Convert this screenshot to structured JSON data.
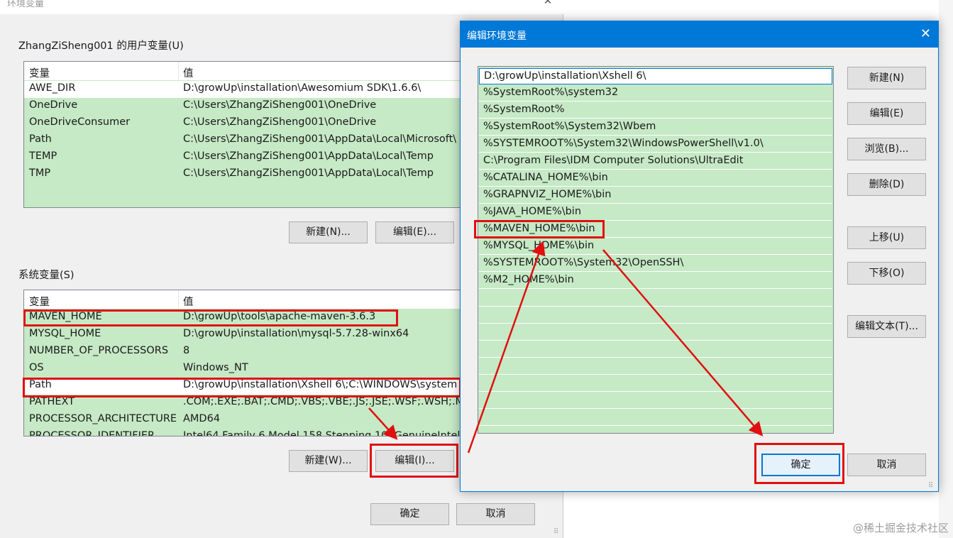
{
  "bg_dialog": {
    "title": "环境变量",
    "close_icon": "close-icon",
    "user_section": {
      "label": "ZhangZiSheng001 的用户变量(U)",
      "col_var": "变量",
      "col_val": "值",
      "rows": [
        {
          "name": "AWE_DIR",
          "value": "D:\\growUp\\installation\\Awesomium SDK\\1.6.6\\"
        },
        {
          "name": "OneDrive",
          "value": "C:\\Users\\ZhangZiSheng001\\OneDrive"
        },
        {
          "name": "OneDriveConsumer",
          "value": "C:\\Users\\ZhangZiSheng001\\OneDrive"
        },
        {
          "name": "Path",
          "value": "C:\\Users\\ZhangZiSheng001\\AppData\\Local\\Microsoft\\"
        },
        {
          "name": "TEMP",
          "value": "C:\\Users\\ZhangZiSheng001\\AppData\\Local\\Temp"
        },
        {
          "name": "TMP",
          "value": "C:\\Users\\ZhangZiSheng001\\AppData\\Local\\Temp"
        }
      ],
      "new_button": "新建(N)...",
      "edit_button": "编辑(E)..."
    },
    "system_section": {
      "label": "系统变量(S)",
      "col_var": "变量",
      "col_val": "值",
      "rows": [
        {
          "name": "MAVEN_HOME",
          "value": "D:\\growUp\\tools\\apache-maven-3.6.3"
        },
        {
          "name": "MYSQL_HOME",
          "value": "D:\\growUp\\installation\\mysql-5.7.28-winx64"
        },
        {
          "name": "NUMBER_OF_PROCESSORS",
          "value": "8"
        },
        {
          "name": "OS",
          "value": "Windows_NT"
        },
        {
          "name": "Path",
          "value": "D:\\growUp\\installation\\Xshell 6\\;C:\\WINDOWS\\system"
        },
        {
          "name": "PATHEXT",
          "value": ".COM;.EXE;.BAT;.CMD;.VBS;.VBE;.JS;.JSE;.WSF;.WSH;.M"
        },
        {
          "name": "PROCESSOR_ARCHITECTURE",
          "value": "AMD64"
        },
        {
          "name": "PROCESSOR_IDENTIFIER",
          "value": "Intel64 Family 6 Model 158 Stepping 10, GenuineIntel"
        }
      ],
      "new_button": "新建(W)...",
      "edit_button": "编辑(I)..."
    },
    "ok_button": "确定",
    "cancel_button": "取消"
  },
  "fg_dialog": {
    "title": "编辑环境变量",
    "close_icon": "close-icon",
    "paths": [
      "D:\\growUp\\installation\\Xshell 6\\",
      "%SystemRoot%\\system32",
      "%SystemRoot%",
      "%SystemRoot%\\System32\\Wbem",
      "%SYSTEMROOT%\\System32\\WindowsPowerShell\\v1.0\\",
      "C:\\Program Files\\IDM Computer Solutions\\UltraEdit",
      "%CATALINA_HOME%\\bin",
      "%GRAPNVIZ_HOME%\\bin",
      "%JAVA_HOME%\\bin",
      "%MAVEN_HOME%\\bin",
      "%MYSQL_HOME%\\bin",
      "%SYSTEMROOT%\\System32\\OpenSSH\\",
      "%M2_HOME%\\bin"
    ],
    "selected_index": 0,
    "buttons": {
      "new": "新建(N)",
      "edit": "编辑(E)",
      "browse": "浏览(B)...",
      "delete": "删除(D)",
      "move_up": "上移(U)",
      "move_down": "下移(O)",
      "edit_text": "编辑文本(T)..."
    },
    "ok_button": "确定",
    "cancel_button": "取消"
  },
  "watermark": "@稀土掘金技术社区",
  "colors": {
    "highlight_red": "#e01010",
    "list_green": "#c6e9c6",
    "title_blue": "#0078d7"
  }
}
